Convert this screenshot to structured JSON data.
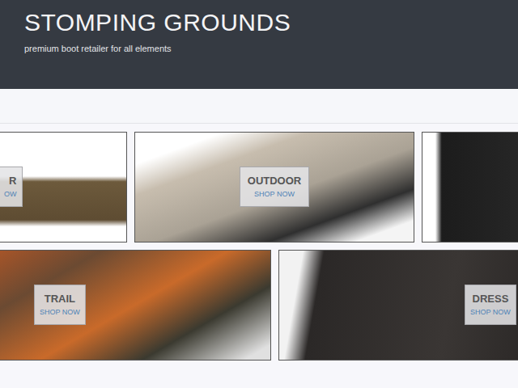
{
  "header": {
    "title": "STOMPING GROUNDS",
    "tagline": "premium boot retailer for all elements"
  },
  "rows": [
    {
      "tiles": [
        {
          "label": "R",
          "action": "OW"
        },
        {
          "label": "OUTDOOR",
          "action": "SHOP NOW"
        },
        {}
      ]
    },
    {
      "tiles": [
        {
          "label": "TRAIL",
          "action": "SHOP NOW"
        },
        {
          "label": "DRESS",
          "action": "SHOP NOW"
        }
      ]
    }
  ]
}
